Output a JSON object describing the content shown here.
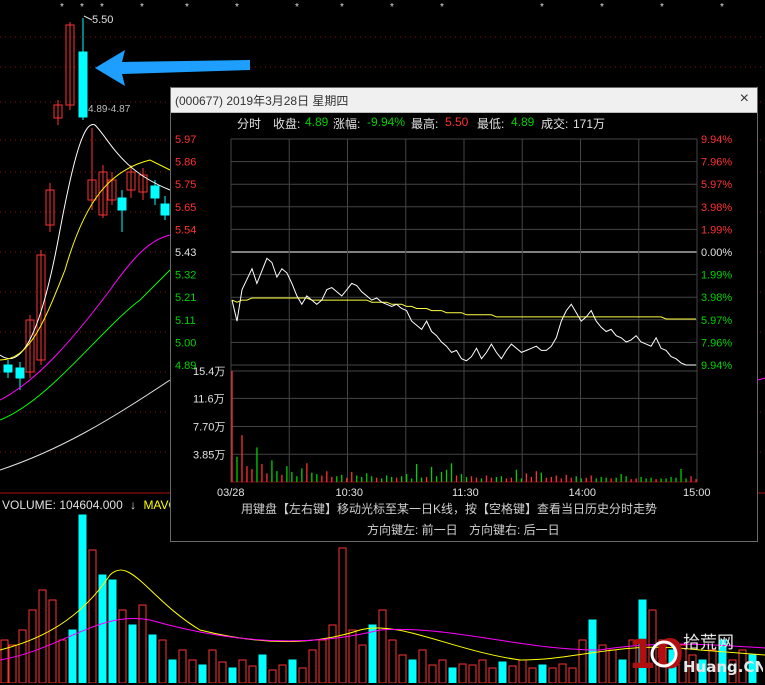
{
  "background_chart": {
    "peak_label": "5.50",
    "range_label": "4.89-4.87",
    "volume_label": "VOLUME: 104604.000",
    "volume_arrow": "↓",
    "ma_label": "MAVO",
    "colors": {
      "up": "#ff3333",
      "down": "#00ffff",
      "ma5": "#ffffff",
      "ma10": "#ffff00",
      "ma20": "#ff00ff",
      "ma60": "#00ff00",
      "arrow": "#1e9fff"
    }
  },
  "popup": {
    "title": "(000677) 2019年3月28日 星期四",
    "close_label": "×",
    "info": {
      "tab": "分时",
      "close_label": "收盘:",
      "close_value": "4.89",
      "change_label": "涨幅:",
      "change_value": "-9.94%",
      "high_label": "最高:",
      "high_value": "5.50",
      "low_label": "最低:",
      "low_value": "4.89",
      "volume_label": "成交:",
      "volume_value": "171万"
    },
    "hint_line1": "用键盘【左右键】移动光标至某一日K线，按【空格键】查看当日历史分时走势",
    "hint_line2_left": "方向键左: 前一日",
    "hint_line2_right": "方向键右: 后一日"
  },
  "chart_data": {
    "type": "line",
    "price_left_ticks": [
      "5.97",
      "5.86",
      "5.75",
      "5.65",
      "5.54",
      "5.43",
      "5.32",
      "5.21",
      "5.11",
      "5.00",
      "4.89"
    ],
    "price_right_ticks": [
      "9.94%",
      "7.96%",
      "5.97%",
      "3.98%",
      "1.99%",
      "0.00%",
      "1.99%",
      "3.98%",
      "5.97%",
      "7.96%",
      "9.94%"
    ],
    "volume_ticks": [
      "15.4万",
      "11.6万",
      "7.70万",
      "3.85万"
    ],
    "x_ticks": [
      "03/28",
      "10:30",
      "11:30",
      "14:00",
      "15:00"
    ],
    "prev_close": 5.43,
    "ylim": [
      4.89,
      5.97
    ],
    "price": [
      5.2,
      5.1,
      5.25,
      5.3,
      5.35,
      5.28,
      5.34,
      5.4,
      5.38,
      5.31,
      5.35,
      5.33,
      5.28,
      5.22,
      5.18,
      5.22,
      5.2,
      5.18,
      5.2,
      5.25,
      5.26,
      5.24,
      5.22,
      5.25,
      5.28,
      5.27,
      5.24,
      5.22,
      5.2,
      5.21,
      5.19,
      5.18,
      5.17,
      5.18,
      5.16,
      5.15,
      5.1,
      5.08,
      5.06,
      5.1,
      5.05,
      5.03,
      5.0,
      4.98,
      4.95,
      4.96,
      4.92,
      4.91,
      4.93,
      4.97,
      4.92,
      4.95,
      4.99,
      4.95,
      4.92,
      4.96,
      4.99,
      4.97,
      4.95,
      4.96,
      4.97,
      4.98,
      4.96,
      4.96,
      4.98,
      5.02,
      5.1,
      5.15,
      5.18,
      5.14,
      5.1,
      5.12,
      5.15,
      5.1,
      5.07,
      5.05,
      5.06,
      5.03,
      5.02,
      5.0,
      5.01,
      5.03,
      5.0,
      4.99,
      4.98,
      5.02,
      4.97,
      4.96,
      4.93,
      4.92,
      4.9,
      4.89,
      4.89,
      4.89
    ],
    "avg": [
      5.2,
      5.19,
      5.2,
      5.2,
      5.21,
      5.21,
      5.21,
      5.21,
      5.21,
      5.21,
      5.21,
      5.21,
      5.21,
      5.21,
      5.21,
      5.21,
      5.2,
      5.2,
      5.2,
      5.2,
      5.2,
      5.2,
      5.2,
      5.2,
      5.2,
      5.2,
      5.2,
      5.2,
      5.19,
      5.19,
      5.19,
      5.19,
      5.18,
      5.18,
      5.18,
      5.17,
      5.17,
      5.16,
      5.16,
      5.16,
      5.15,
      5.15,
      5.15,
      5.14,
      5.14,
      5.14,
      5.14,
      5.13,
      5.13,
      5.13,
      5.13,
      5.13,
      5.13,
      5.12,
      5.12,
      5.12,
      5.12,
      5.12,
      5.12,
      5.12,
      5.12,
      5.12,
      5.12,
      5.12,
      5.12,
      5.12,
      5.12,
      5.12,
      5.12,
      5.12,
      5.12,
      5.12,
      5.12,
      5.12,
      5.12,
      5.12,
      5.12,
      5.12,
      5.12,
      5.12,
      5.12,
      5.12,
      5.12,
      5.12,
      5.12,
      5.12,
      5.12,
      5.11,
      5.11,
      5.11,
      5.11,
      5.11,
      5.11,
      5.11
    ],
    "volume": [
      15.4,
      3.5,
      6.5,
      2.2,
      1.8,
      4.8,
      2.5,
      1.2,
      3.0,
      1.5,
      1.0,
      2.2,
      1.4,
      0.8,
      1.9,
      2.6,
      1.3,
      1.1,
      0.9,
      1.5,
      0.7,
      0.8,
      1.0,
      0.6,
      1.4,
      0.9,
      0.7,
      1.2,
      0.8,
      0.6,
      0.5,
      0.9,
      0.7,
      0.6,
      0.8,
      1.1,
      0.5,
      2.5,
      0.6,
      0.7,
      2.1,
      0.8,
      1.4,
      1.7,
      2.6,
      0.9,
      1.1,
      0.7,
      0.8,
      0.6,
      0.5,
      0.9,
      0.6,
      0.7,
      0.8,
      0.5,
      0.6,
      1.7,
      0.5,
      1.2,
      0.7,
      1.5,
      1.3,
      0.6,
      0.7,
      0.9,
      0.5,
      1.0,
      0.6,
      0.8,
      0.5,
      0.6,
      0.9,
      0.5,
      0.7,
      0.6,
      0.5,
      0.6,
      1.1,
      0.8,
      0.4,
      0.5,
      0.7,
      0.5,
      0.6,
      0.4,
      0.5,
      0.5,
      0.7,
      0.6,
      1.8,
      0.5,
      0.8,
      0.4
    ]
  }
}
